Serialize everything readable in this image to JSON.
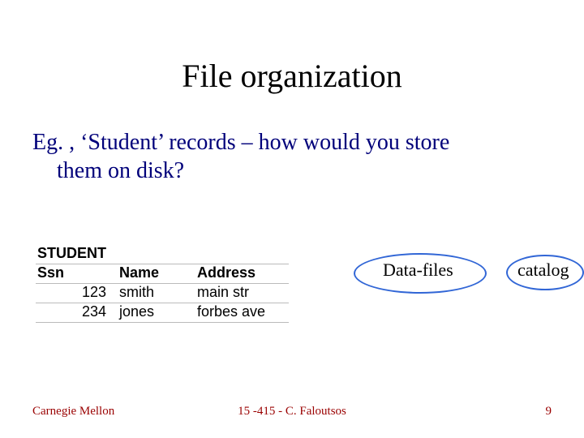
{
  "title": "File organization",
  "body": {
    "line1": "Eg. , ‘Student’ records – how would you store",
    "line2": "them on disk?"
  },
  "table": {
    "header_label": "STUDENT",
    "cols": {
      "ssn": "Ssn",
      "name": "Name",
      "address": "Address"
    },
    "rows": [
      {
        "ssn": "123",
        "name": "smith",
        "address": "main str"
      },
      {
        "ssn": "234",
        "name": "jones",
        "address": "forbes ave"
      }
    ]
  },
  "labels": {
    "datafiles": "Data-files",
    "catalog": "catalog"
  },
  "footer": {
    "left": "Carnegie Mellon",
    "center": "15 -415 - C. Faloutsos",
    "right": "9"
  },
  "chart_data": {
    "type": "table",
    "title": "STUDENT",
    "columns": [
      "Ssn",
      "Name",
      "Address"
    ],
    "rows": [
      [
        "123",
        "smith",
        "main str"
      ],
      [
        "234",
        "jones",
        "forbes ave"
      ]
    ]
  }
}
